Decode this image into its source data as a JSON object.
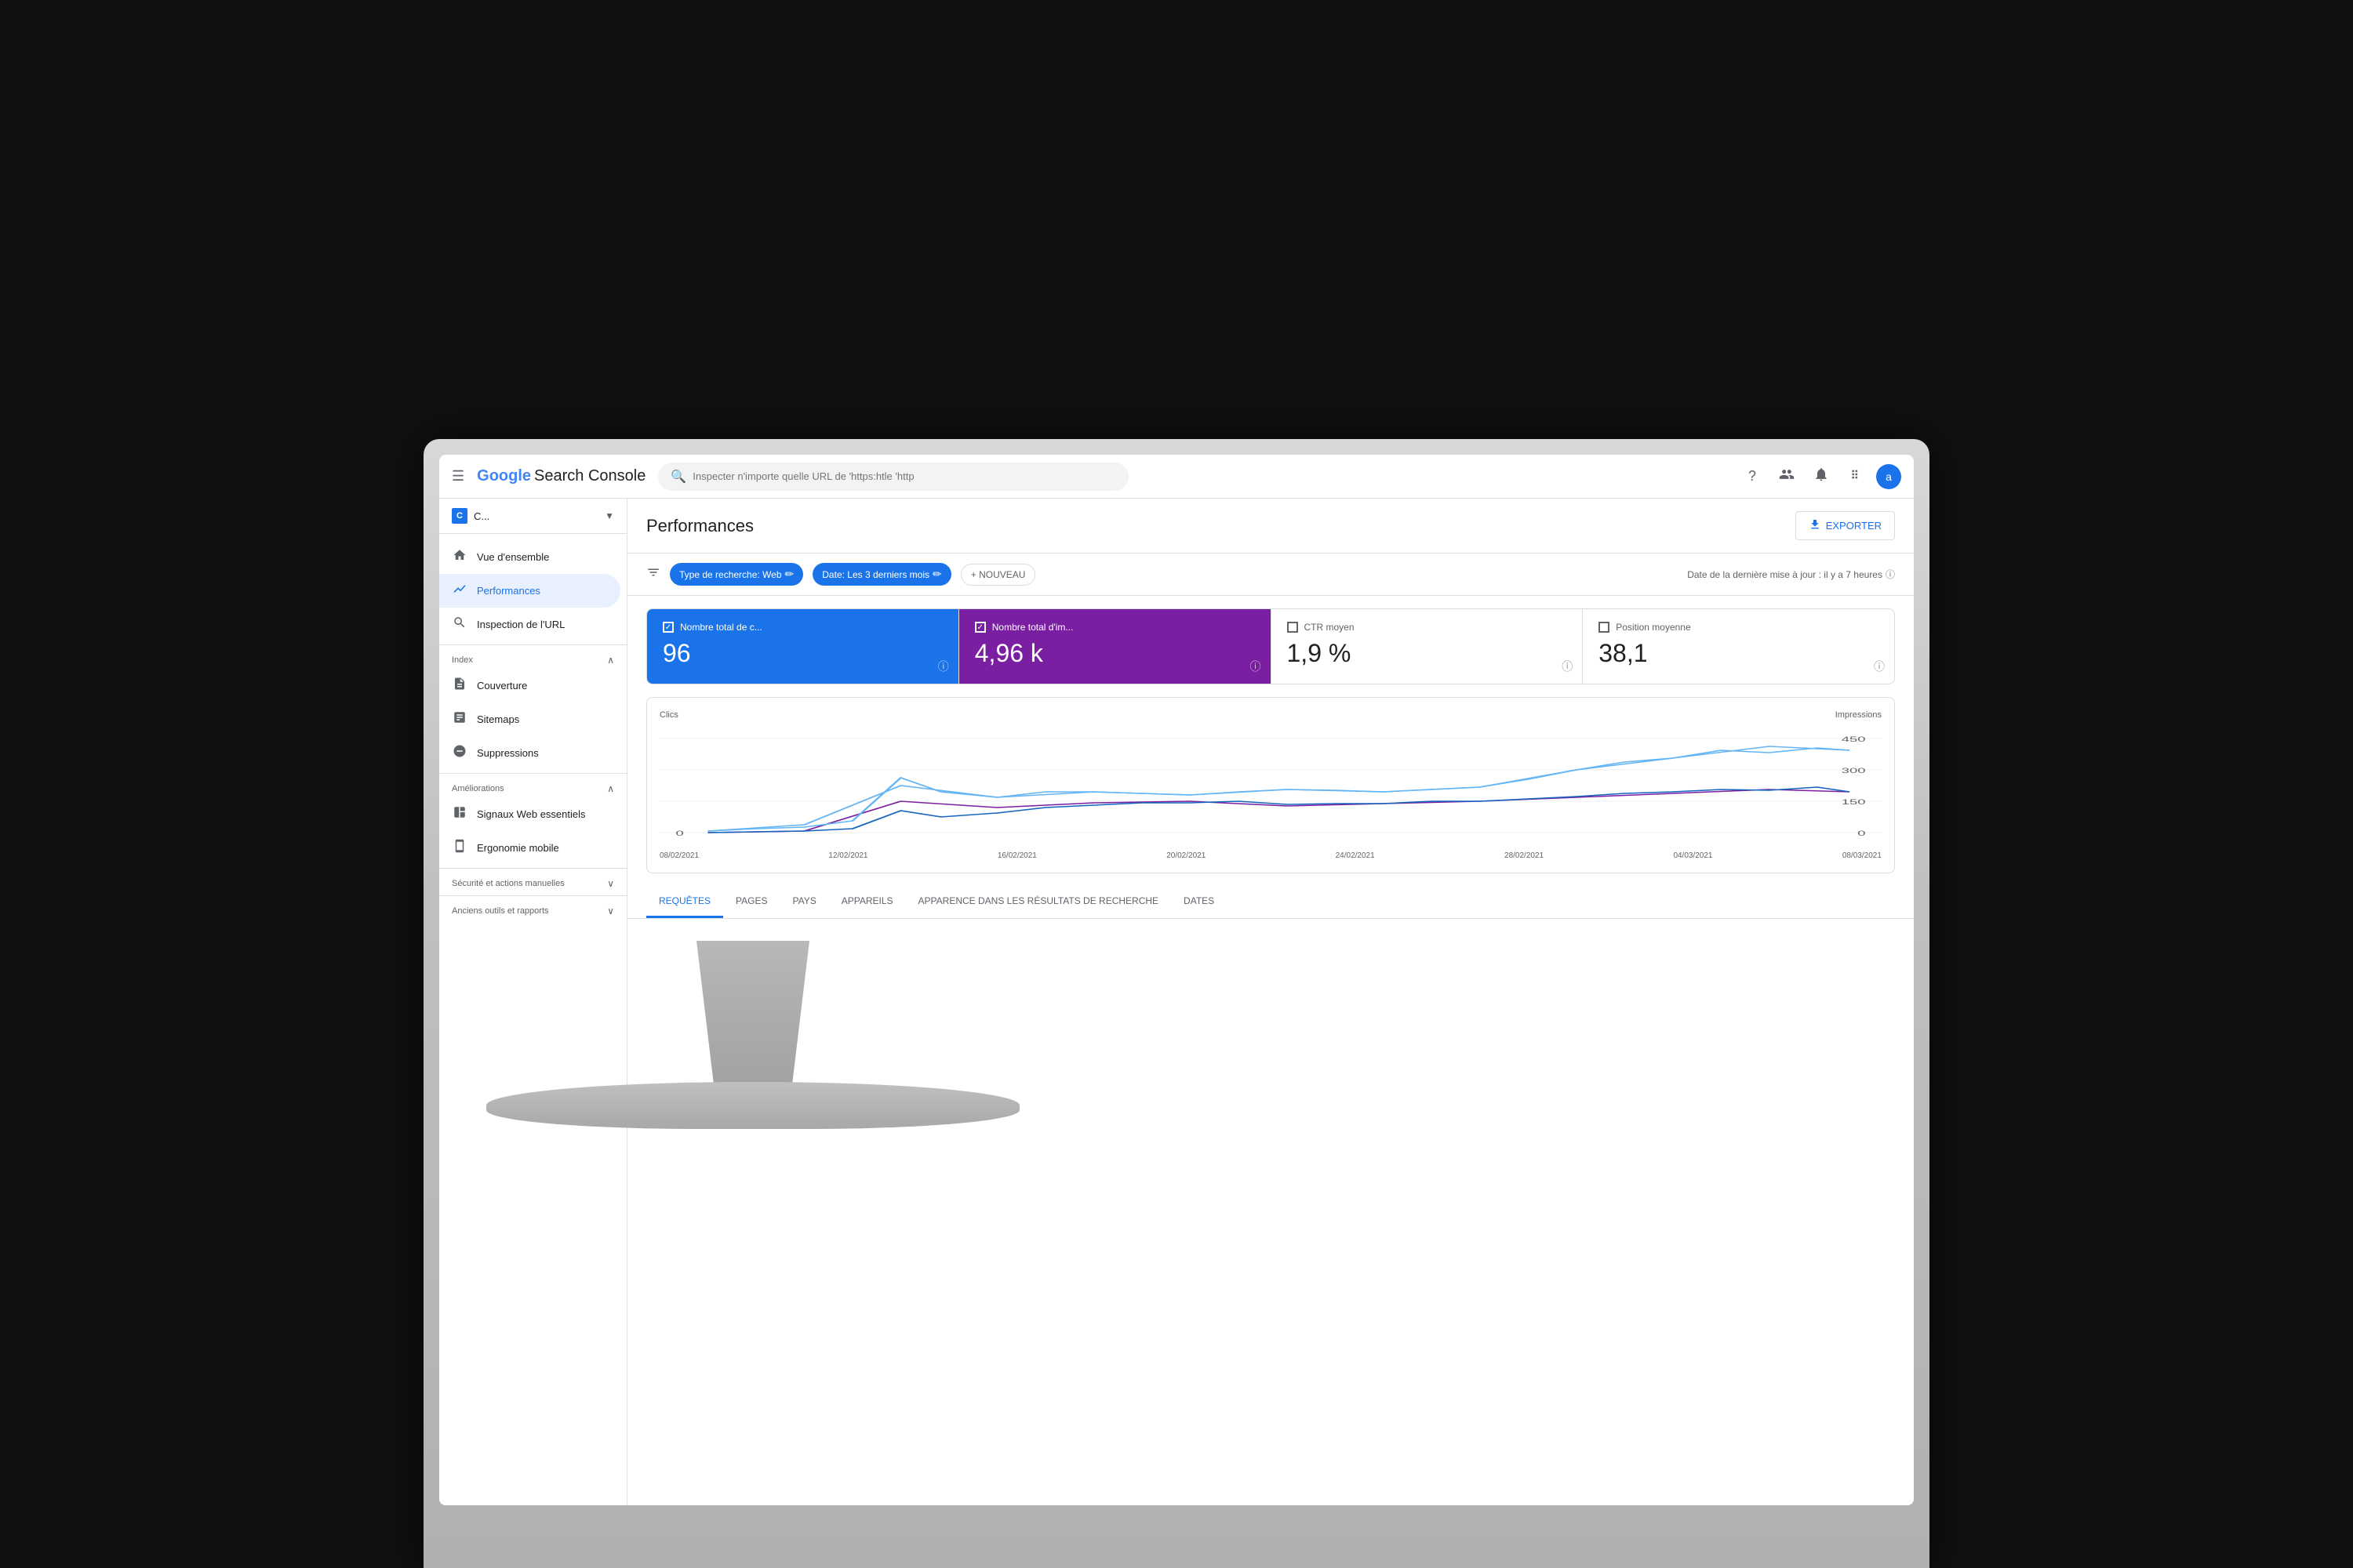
{
  "topbar": {
    "logo": "Google Search Console",
    "logo_google": "Google",
    "logo_rest": "Search Console",
    "search_placeholder": "Inspecter n'importe quelle URL de 'https:htle 'http",
    "icons": {
      "help": "?",
      "users": "👤",
      "bell": "🔔",
      "apps": "⋮⋮",
      "avatar": "a"
    }
  },
  "sidebar": {
    "property_icon": "C",
    "property_name": "C...",
    "nav_items": [
      {
        "id": "overview",
        "label": "Vue d'ensemble",
        "icon": "🏠",
        "active": false
      },
      {
        "id": "performances",
        "label": "Performances",
        "icon": "📈",
        "active": true
      },
      {
        "id": "url-inspection",
        "label": "Inspection de l'URL",
        "icon": "🔍",
        "active": false
      }
    ],
    "sections": [
      {
        "id": "index",
        "label": "Index",
        "expanded": true,
        "items": [
          {
            "id": "couverture",
            "label": "Couverture",
            "icon": "📄"
          },
          {
            "id": "sitemaps",
            "label": "Sitemaps",
            "icon": "📋"
          },
          {
            "id": "suppressions",
            "label": "Suppressions",
            "icon": "🚫"
          }
        ]
      },
      {
        "id": "ameliorations",
        "label": "Améliorations",
        "expanded": true,
        "items": [
          {
            "id": "signaux-web",
            "label": "Signaux Web essentiels",
            "icon": "⏱"
          },
          {
            "id": "ergonomie",
            "label": "Ergonomie mobile",
            "icon": "📱"
          }
        ]
      },
      {
        "id": "securite",
        "label": "Sécurité et actions manuelles",
        "expanded": false,
        "items": []
      },
      {
        "id": "anciens",
        "label": "Anciens outils et rapports",
        "expanded": false,
        "items": []
      }
    ]
  },
  "content": {
    "page_title": "Performances",
    "export_label": "EXPORTER",
    "filter_bar": {
      "search_type_label": "Type de recherche: Web",
      "date_label": "Date: Les 3 derniers mois",
      "new_label": "+ NOUVEAU",
      "update_info": "Date de la dernière mise à jour : il y a 7 heures"
    },
    "metrics": [
      {
        "id": "clics",
        "label": "Nombre total de c...",
        "value": "96",
        "active": true,
        "color": "blue"
      },
      {
        "id": "impressions",
        "label": "Nombre total d'im...",
        "value": "4,96 k",
        "active": true,
        "color": "purple"
      },
      {
        "id": "ctr",
        "label": "CTR moyen",
        "value": "1,9 %",
        "active": false,
        "color": "none"
      },
      {
        "id": "position",
        "label": "Position moyenne",
        "value": "38,1",
        "active": false,
        "color": "none"
      }
    ],
    "chart": {
      "left_label": "Clics",
      "right_label": "Impressions",
      "right_values": [
        "450",
        "300",
        "150",
        "0"
      ],
      "left_values": [
        "",
        "",
        "",
        "0"
      ],
      "x_labels": [
        "08/02/2021",
        "12/02/2021",
        "16/02/2021",
        "20/02/2021",
        "24/02/2021",
        "28/02/2021",
        "04/03/2021",
        "08/03/2021"
      ]
    },
    "tabs": [
      {
        "id": "requetes",
        "label": "REQUÊTES",
        "active": true
      },
      {
        "id": "pages",
        "label": "PAGES",
        "active": false
      },
      {
        "id": "pays",
        "label": "PAYS",
        "active": false
      },
      {
        "id": "appareils",
        "label": "APPAREILS",
        "active": false
      },
      {
        "id": "apparence",
        "label": "APPARENCE DANS LES RÉSULTATS DE RECHERCHE",
        "active": false
      },
      {
        "id": "dates",
        "label": "DATES",
        "active": false
      }
    ]
  },
  "monitor": {
    "apple_logo": ""
  }
}
